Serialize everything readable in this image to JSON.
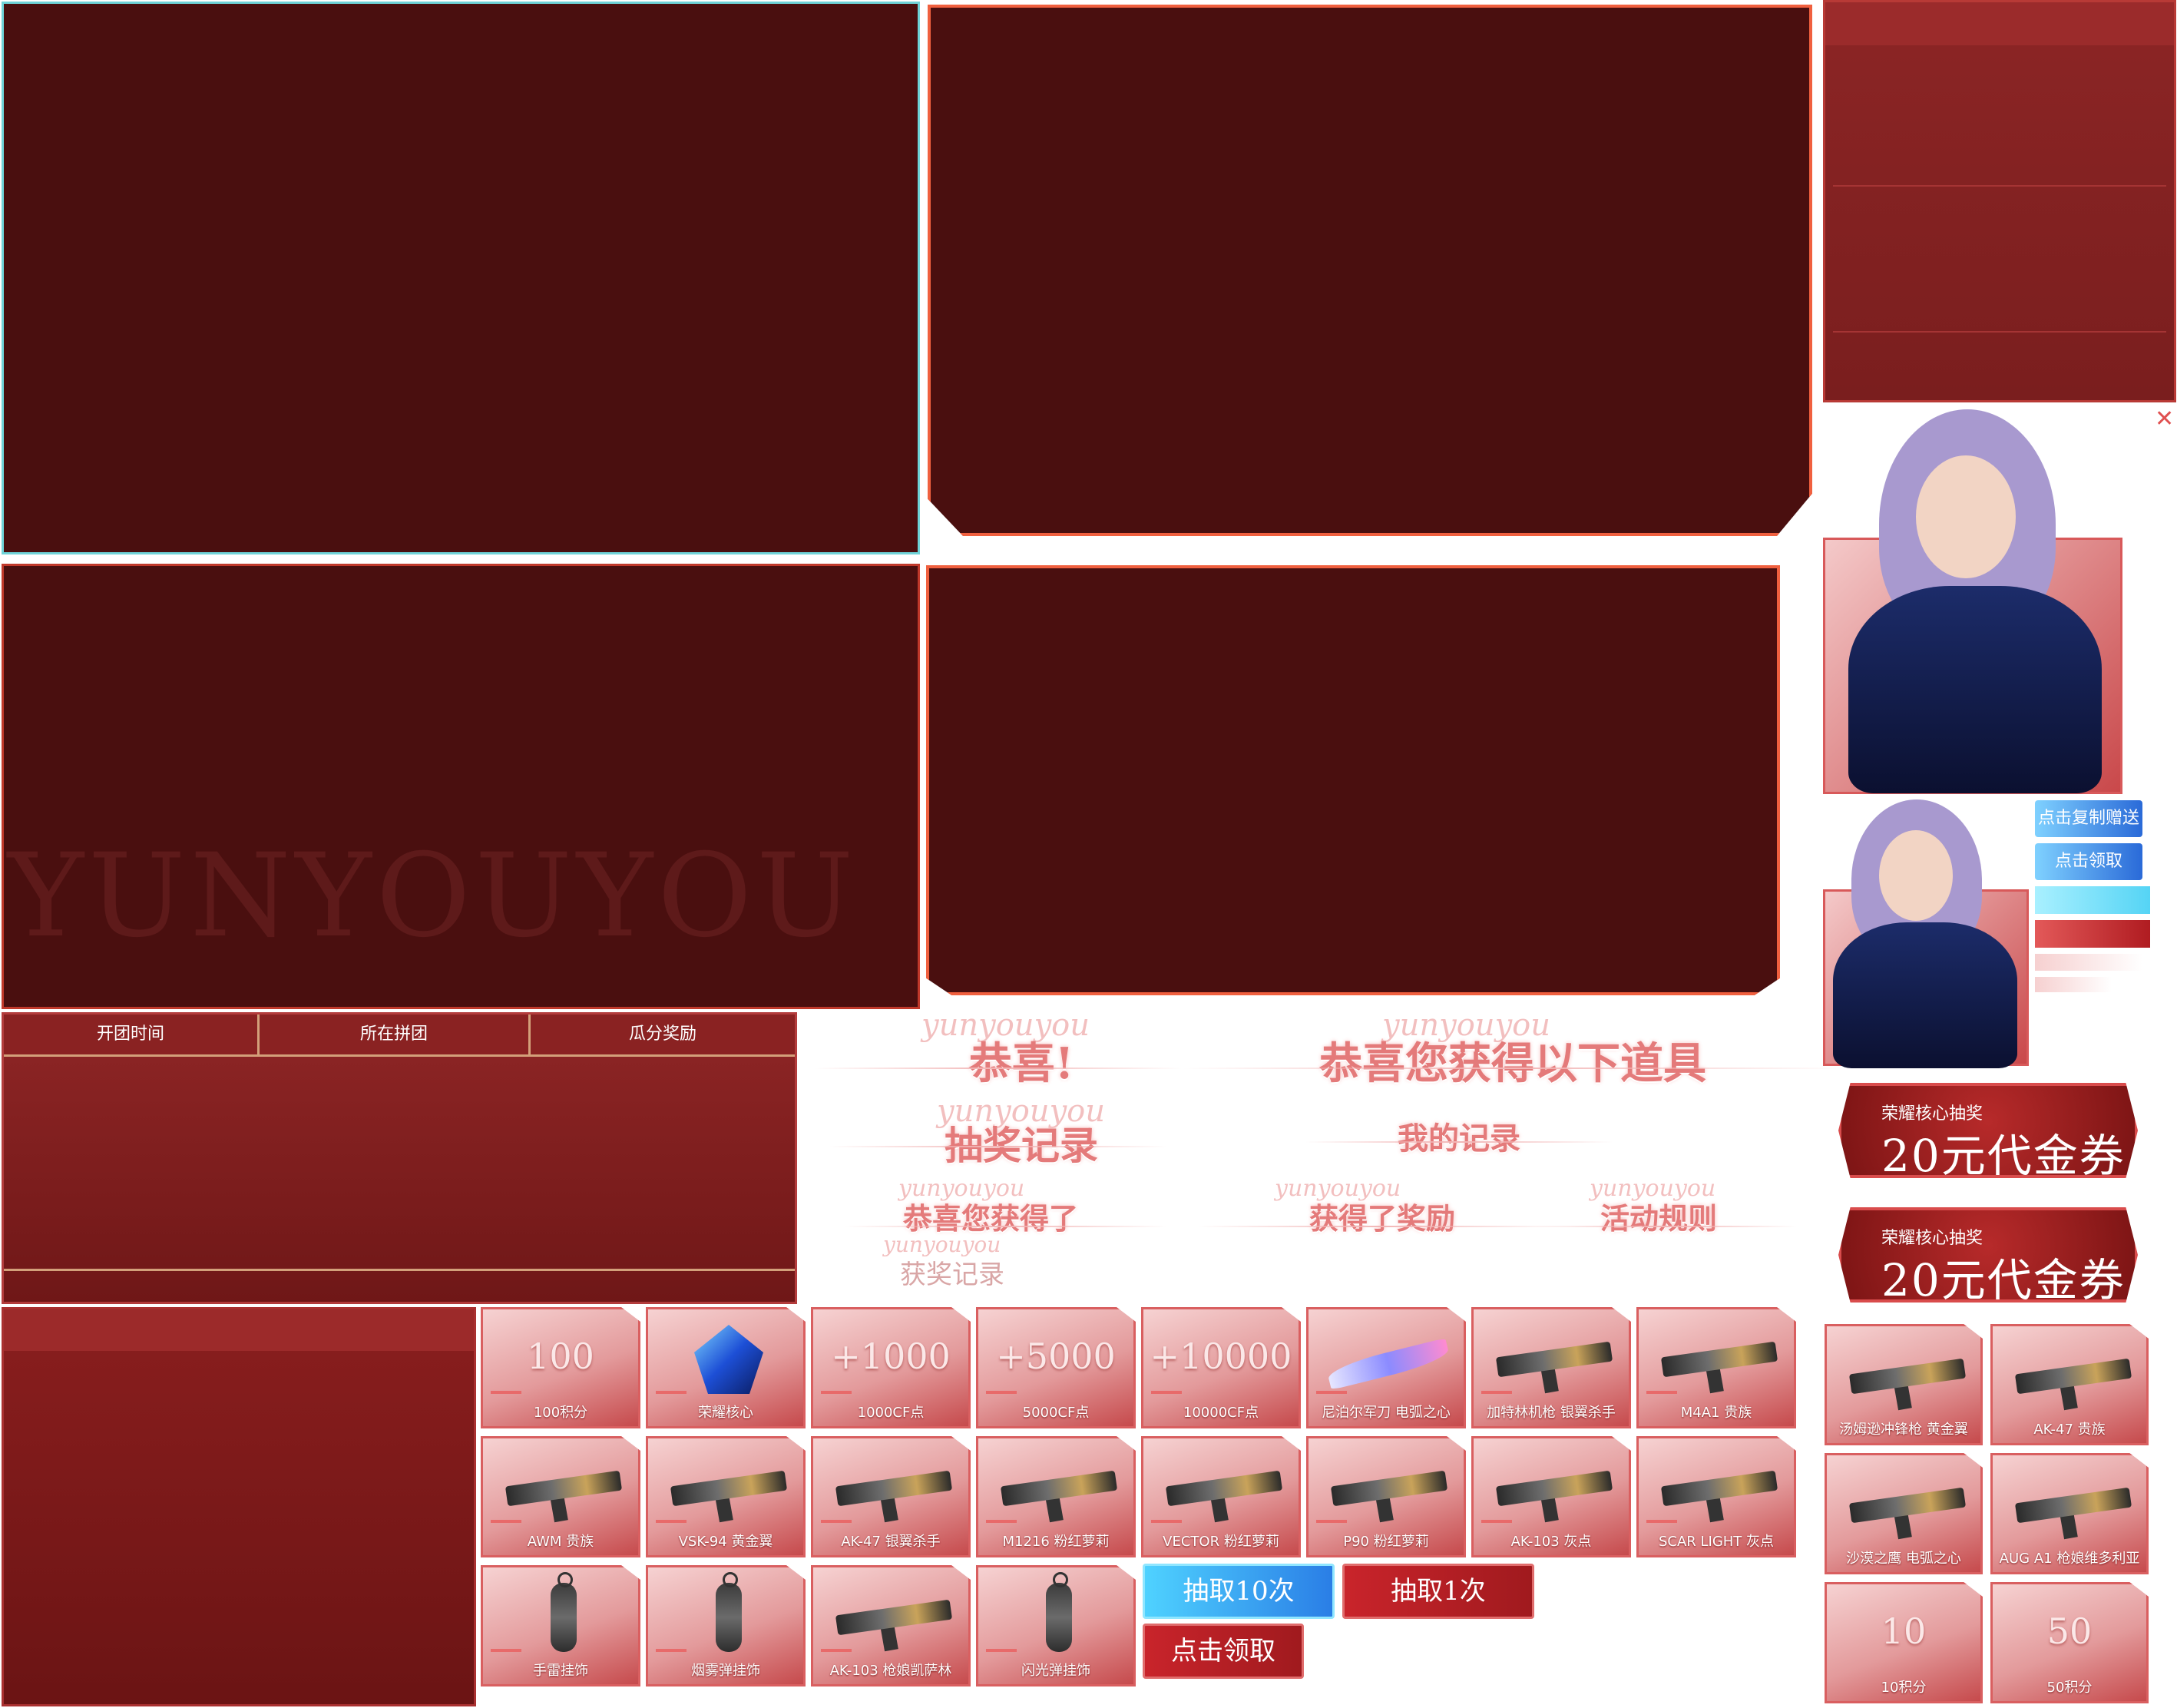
{
  "watermark": "YUNYOUYOU",
  "close_glyph": "✕",
  "side_buttons": {
    "copy_gift": "点击复制赠送",
    "claim": "点击领取"
  },
  "table_headers": [
    "开团时间",
    "所在拼团",
    "瓜分奖励"
  ],
  "titles": {
    "congrats": "恭喜!",
    "congrats_items": "恭喜您获得以下道具",
    "draw_record": "抽奖记录",
    "pinned": "我的记录",
    "reward_col1": "恭喜您获得了",
    "reward_col2": "获得了奖励",
    "reward_col3": "活动规则",
    "award_record": "获奖记录",
    "ghost": "yunyouyou"
  },
  "coupons": [
    {
      "small": "荣耀核心抽奖",
      "big": "20元代金券"
    },
    {
      "small": "荣耀核心抽奖",
      "big": "20元代金券"
    }
  ],
  "items_row1": [
    {
      "label": "100积分",
      "num": "100",
      "icon": "points-icon"
    },
    {
      "label": "荣耀核心",
      "num": "",
      "icon": "glory-core-icon"
    },
    {
      "label": "1000CF点",
      "num": "+1000",
      "icon": "cf-points-icon"
    },
    {
      "label": "5000CF点",
      "num": "+5000",
      "icon": "cf-points-icon"
    },
    {
      "label": "10000CF点",
      "num": "+10000",
      "icon": "cf-points-icon"
    },
    {
      "label": "尼泊尔军刀 电弧之心",
      "num": "",
      "icon": "knife-icon"
    },
    {
      "label": "加特林机枪 银翼杀手",
      "num": "",
      "icon": "gatling-icon"
    },
    {
      "label": "M4A1 贵族",
      "num": "",
      "icon": "rifle-icon"
    }
  ],
  "items_row2": [
    {
      "label": "AWM 贵族",
      "icon": "sniper-icon"
    },
    {
      "label": "VSK-94 黄金翼",
      "icon": "sniper-icon"
    },
    {
      "label": "AK-47 银翼杀手",
      "icon": "rifle-icon"
    },
    {
      "label": "M1216 粉红萝莉",
      "icon": "shotgun-icon"
    },
    {
      "label": "VECTOR 粉红萝莉",
      "icon": "smg-icon"
    },
    {
      "label": "P90 粉红萝莉",
      "icon": "smg-icon"
    },
    {
      "label": "AK-103 灰点",
      "icon": "rifle-icon"
    },
    {
      "label": "SCAR LIGHT 灰点",
      "icon": "rifle-icon"
    }
  ],
  "items_row3": [
    {
      "label": "手雷挂饰",
      "icon": "grenade-pendant-icon"
    },
    {
      "label": "烟雾弹挂饰",
      "icon": "smoke-pendant-icon"
    },
    {
      "label": "AK-103 枪娘凯萨林",
      "icon": "rifle-icon"
    },
    {
      "label": "闪光弹挂饰",
      "icon": "flash-pendant-icon"
    }
  ],
  "right_items": [
    {
      "label": "汤姆逊冲锋枪  黄金翼",
      "num": "",
      "icon": "smg-icon"
    },
    {
      "label": "AK-47 贵族",
      "num": "",
      "icon": "rifle-icon"
    },
    {
      "label": "沙漠之鹰  电弧之心",
      "num": "",
      "icon": "pistol-icon"
    },
    {
      "label": "AUG A1 枪娘维多利亚",
      "num": "",
      "icon": "rifle-icon"
    },
    {
      "label": "10积分",
      "num": "10",
      "icon": "points-icon"
    },
    {
      "label": "50积分",
      "num": "50",
      "icon": "points-icon"
    }
  ],
  "buttons": {
    "draw10": "抽取10次",
    "draw1": "抽取1次",
    "claim": "点击领取"
  }
}
